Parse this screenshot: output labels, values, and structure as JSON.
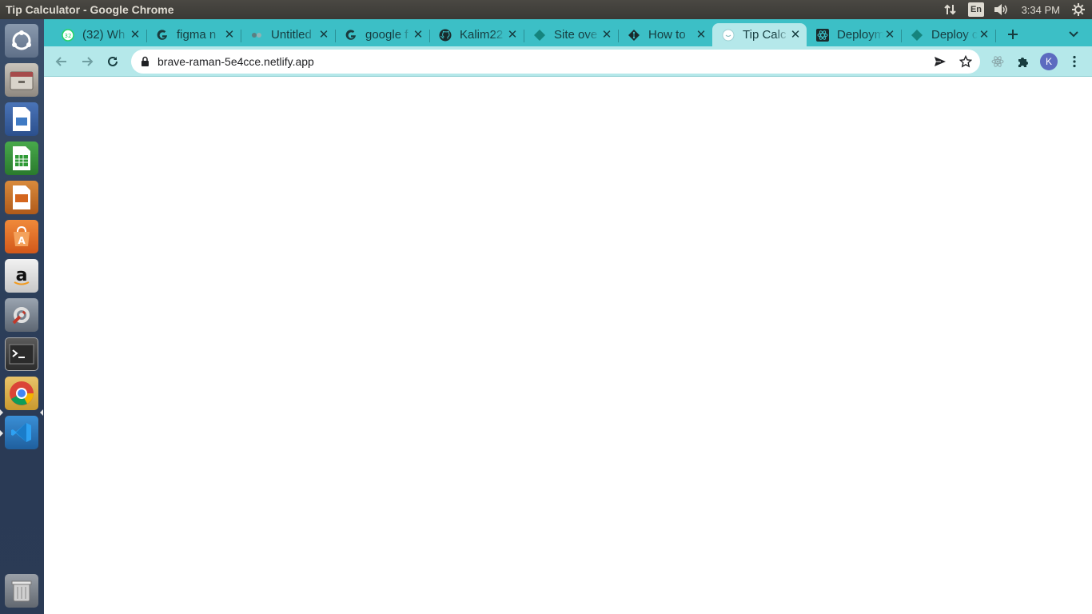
{
  "window": {
    "title": "Tip Calculator - Google Chrome"
  },
  "system_tray": {
    "language": "En",
    "clock": "3:34 PM"
  },
  "launcher": {
    "items": [
      {
        "name": "ubuntu-dash"
      },
      {
        "name": "files"
      },
      {
        "name": "libreoffice-writer"
      },
      {
        "name": "libreoffice-calc"
      },
      {
        "name": "libreoffice-impress"
      },
      {
        "name": "ubuntu-software"
      },
      {
        "name": "amazon"
      },
      {
        "name": "system-settings"
      },
      {
        "name": "terminal"
      },
      {
        "name": "google-chrome"
      },
      {
        "name": "vscode"
      },
      {
        "name": "trash"
      }
    ]
  },
  "tabs": [
    {
      "label": "(32) Wh",
      "icon": "whatsapp-icon",
      "badge": "32",
      "active": false
    },
    {
      "label": "figma n",
      "icon": "google-icon",
      "active": false
    },
    {
      "label": "Untitled",
      "icon": "figma-icon",
      "active": false
    },
    {
      "label": "google f",
      "icon": "google-icon",
      "active": false
    },
    {
      "label": "Kalim22",
      "icon": "github-icon",
      "active": false
    },
    {
      "label": "Site ove",
      "icon": "netlify-icon",
      "active": false
    },
    {
      "label": "How to",
      "icon": "git-icon",
      "active": false
    },
    {
      "label": "Tip Calc",
      "icon": "page-icon",
      "active": true
    },
    {
      "label": "Deploym",
      "icon": "react-icon",
      "active": false
    },
    {
      "label": "Deploy c",
      "icon": "netlify-icon",
      "active": false
    }
  ],
  "toolbar": {
    "url": "brave-raman-5e4cce.netlify.app",
    "profile_initial": "K"
  },
  "colors": {
    "tabstrip": "#3cbfc6",
    "toolbar": "#b5e8ea",
    "active_tab": "#b5e8ea",
    "profile": "#5c6bc0"
  }
}
